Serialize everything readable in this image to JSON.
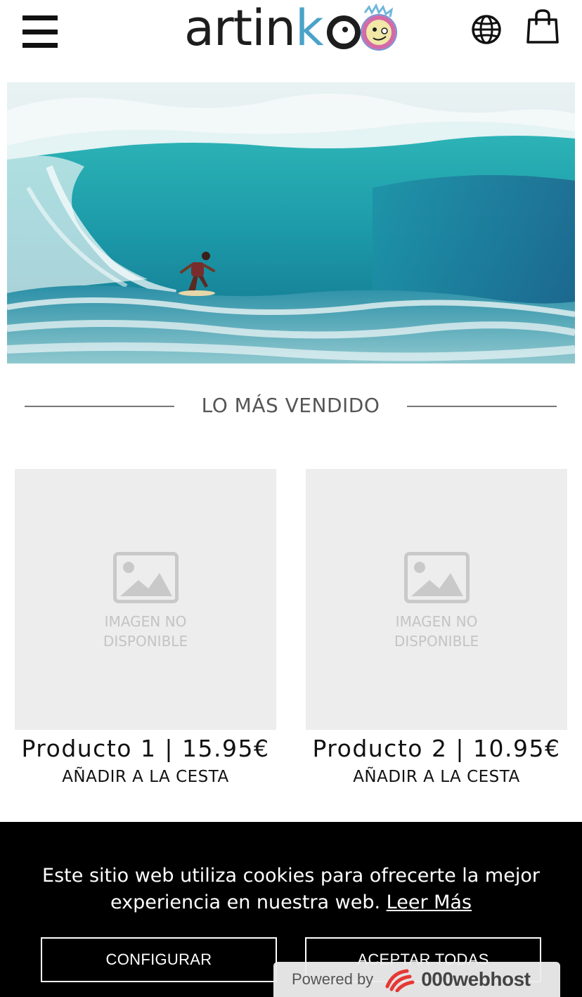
{
  "header": {
    "logo": {
      "part1": "artin",
      "part2": "k",
      "part3": "oo"
    },
    "menu_icon": "hamburger-menu-icon",
    "language_icon": "globe-icon",
    "cart_icon": "shopping-bag-icon"
  },
  "hero": {
    "image": "surfer-on-wave-photo"
  },
  "section": {
    "title": "LO MÁS VENDIDO"
  },
  "products": [
    {
      "placeholder_line1": "IMAGEN NO",
      "placeholder_line2": "DISPONIBLE",
      "name": "Producto 1 | 15.95€",
      "add_label": "AÑADIR A LA CESTA"
    },
    {
      "placeholder_line1": "IMAGEN NO",
      "placeholder_line2": "DISPONIBLE",
      "name": "Producto 2 | 10.95€",
      "add_label": "AÑADIR A LA CESTA"
    }
  ],
  "cookie_banner": {
    "message_line1": "Este sitio web utiliza cookies para ofrecerte la mejor",
    "message_line2": "experiencia en nuestra web.",
    "read_more": "Leer Más",
    "configure_label": "CONFIGURAR",
    "accept_label": "ACEPTAR TODAS"
  },
  "badge": {
    "powered_by": "Powered by",
    "brand": "000webhost"
  },
  "colors": {
    "logo_blue": "#4aa3c9",
    "logo_dark": "#1d1d1d",
    "banner_bg": "#000000",
    "placeholder_bg": "#ededed"
  }
}
